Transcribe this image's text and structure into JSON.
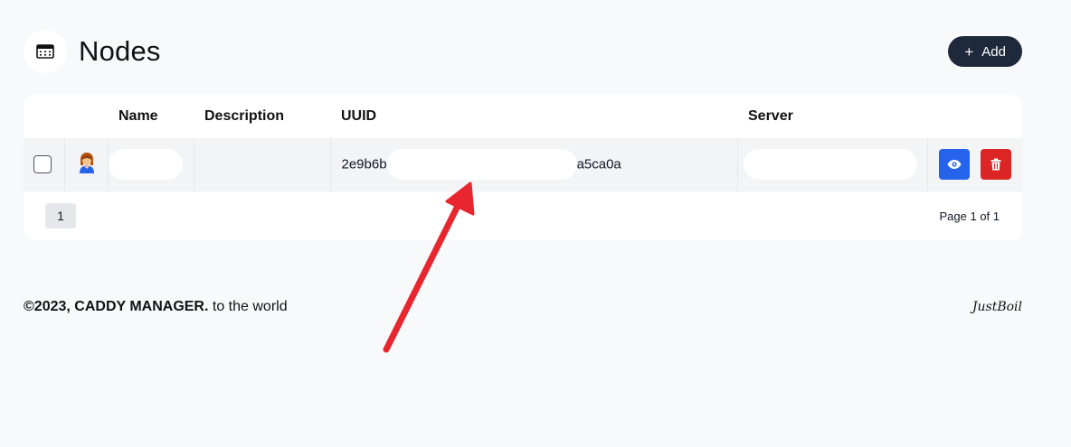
{
  "header": {
    "title": "Nodes",
    "add_label": "Add"
  },
  "table": {
    "columns": [
      "",
      "",
      "Name",
      "Description",
      "UUID",
      "Server",
      ""
    ],
    "rows": [
      {
        "name": "",
        "description": "",
        "uuid_start": "2e9b6b",
        "uuid_end": "a5ca0a",
        "server": ""
      }
    ]
  },
  "pagination": {
    "current_page": "1",
    "page_info": "Page 1 of 1"
  },
  "footer": {
    "copyright_bold": "©2023, CADDY MANAGER.",
    "copyright_rest": " to the world",
    "brand": "JustBoil"
  },
  "colors": {
    "accent_dark": "#1e293b",
    "view_button": "#2563eb",
    "delete_button": "#dc2626",
    "annotation_arrow": "#e8262f"
  },
  "icons": [
    "table-icon",
    "plus-icon",
    "avatar-icon",
    "eye-icon",
    "trash-icon"
  ]
}
